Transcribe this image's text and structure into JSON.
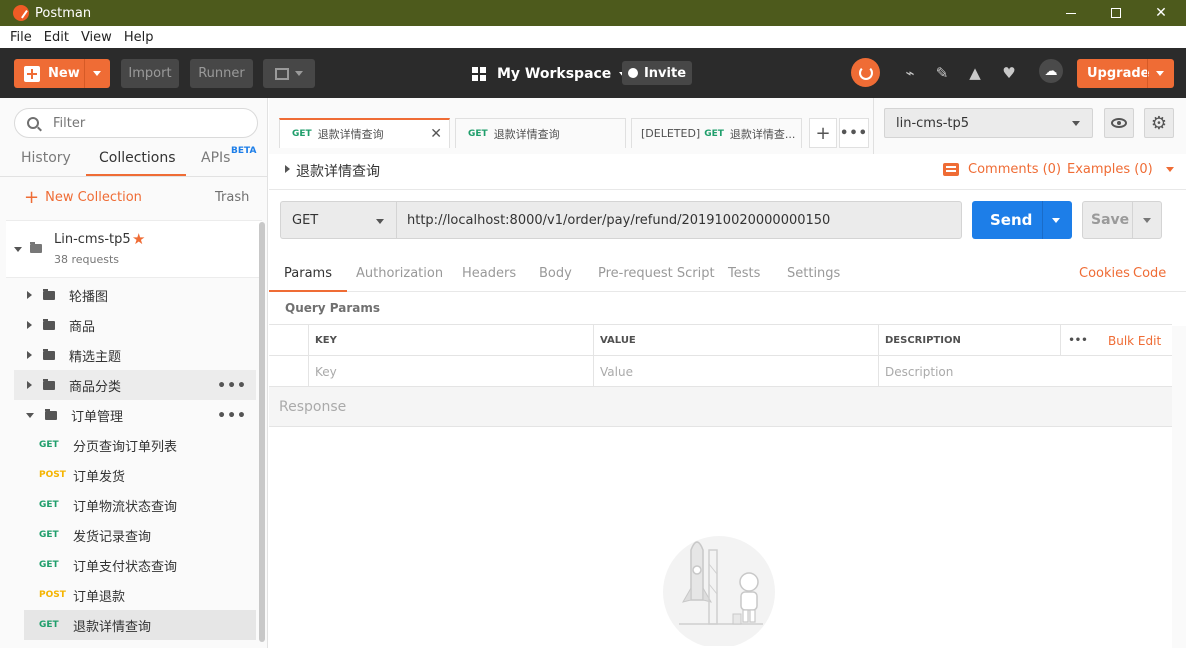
{
  "window": {
    "title": "Postman"
  },
  "menubar": [
    "File",
    "Edit",
    "View",
    "Help"
  ],
  "header": {
    "new_label": "New",
    "import_label": "Import",
    "runner_label": "Runner",
    "workspace_label": "My Workspace",
    "invite_label": "Invite",
    "upgrade_label": "Upgrade"
  },
  "sidebar": {
    "filter_placeholder": "Filter",
    "tabs": {
      "history": "History",
      "collections": "Collections",
      "apis": "APIs",
      "apis_badge": "BETA"
    },
    "new_collection": "New Collection",
    "trash": "Trash",
    "collection": {
      "name": "Lin-cms-tp5",
      "count": "38 requests"
    },
    "folders": [
      {
        "label": "轮播图"
      },
      {
        "label": "商品"
      },
      {
        "label": "精选主题"
      },
      {
        "label": "商品分类"
      },
      {
        "label": "订单管理"
      }
    ],
    "requests": [
      {
        "method": "GET",
        "label": "分页查询订单列表"
      },
      {
        "method": "POST",
        "label": "订单发货"
      },
      {
        "method": "GET",
        "label": "订单物流状态查询"
      },
      {
        "method": "GET",
        "label": "发货记录查询"
      },
      {
        "method": "GET",
        "label": "订单支付状态查询"
      },
      {
        "method": "POST",
        "label": "订单退款"
      },
      {
        "method": "GET",
        "label": "退款详情查询"
      }
    ]
  },
  "tabs": [
    {
      "method": "GET",
      "label": "退款详情查询",
      "prefix": ""
    },
    {
      "method": "GET",
      "label": "退款详情查询",
      "prefix": ""
    },
    {
      "method": "GET",
      "label": "退款详情查...",
      "prefix": "[DELETED]"
    }
  ],
  "environment": {
    "selected": "lin-cms-tp5"
  },
  "request": {
    "title": "退款详情查询",
    "comments": "Comments (0)",
    "examples": "Examples (0)",
    "method": "GET",
    "url": "http://localhost:8000/v1/order/pay/refund/201910020000000150",
    "send_label": "Send",
    "save_label": "Save"
  },
  "request_tabs": {
    "params": "Params",
    "authorization": "Authorization",
    "headers": "Headers",
    "body": "Body",
    "prerequest": "Pre-request Script",
    "tests": "Tests",
    "settings": "Settings",
    "cookies": "Cookies",
    "code": "Code"
  },
  "query_params": {
    "title": "Query Params",
    "col_key": "KEY",
    "col_value": "VALUE",
    "col_description": "DESCRIPTION",
    "bulk_edit": "Bulk Edit",
    "key_placeholder": "Key",
    "value_placeholder": "Value",
    "description_placeholder": "Description"
  },
  "response": {
    "label": "Response"
  },
  "colors": {
    "accent": "#ef6c35",
    "send": "#1d7ee8",
    "get": "#1f9e6b",
    "post": "#f5b400"
  }
}
